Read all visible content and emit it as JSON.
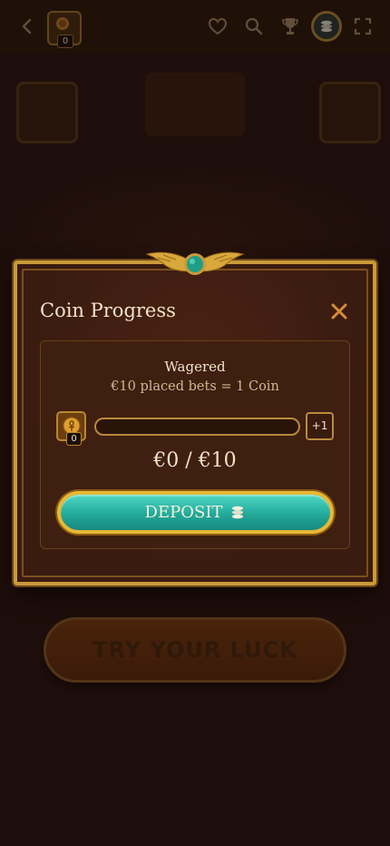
{
  "topbar": {
    "coin_count": "0"
  },
  "background": {
    "try_luck_label": "TRY YOUR LUCK"
  },
  "modal": {
    "title": "Coin Progress",
    "wagered_label": "Wagered",
    "rule_text": "€10 placed bets = 1 Coin",
    "coin_count": "0",
    "progress_fraction": 0,
    "plus_label": "+1",
    "amount_text": "€0 / €10",
    "deposit_label": "DEPOSIT"
  },
  "colors": {
    "accent_gold": "#c99a3a",
    "teal": "#22a99a",
    "cream_text": "#f2e3c6"
  }
}
